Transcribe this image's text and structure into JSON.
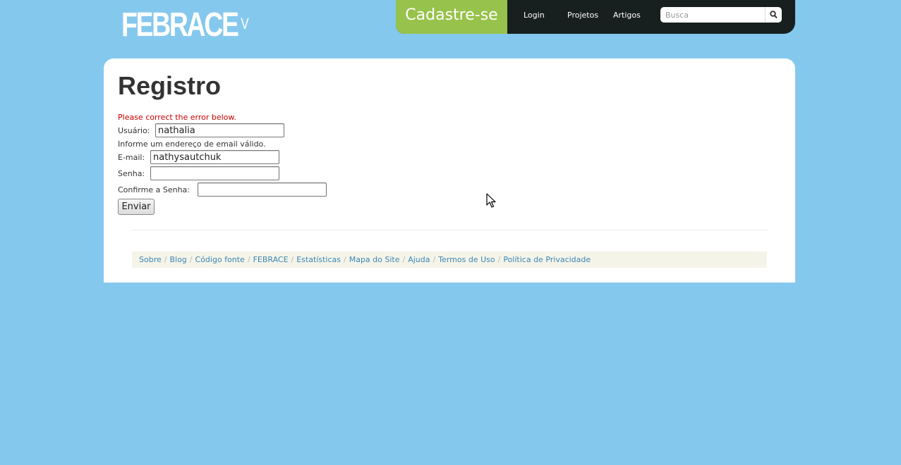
{
  "header": {
    "logo_text": "FEBRACE",
    "logo_sup": "V",
    "cadastre_label": "Cadastre-se",
    "nav": [
      "Login",
      "Projetos",
      "Artigos"
    ],
    "search_placeholder": "Busca",
    "search_icon": "magnifier-icon"
  },
  "form": {
    "title": "Registro",
    "error_message": "Please correct the error below.",
    "usuario_label": "Usuário:",
    "usuario_value": "nathalia",
    "email_error": "Informe um endereço de email válido.",
    "email_label": "E-mail:",
    "email_value": "nathysautchuk",
    "senha_label": "Senha:",
    "senha_value": "",
    "confirme_label": "Confirme a Senha:",
    "confirme_value": "",
    "submit_label": "Enviar"
  },
  "footer": {
    "links": [
      "Sobre",
      "Blog",
      "Código fonte",
      "FEBRACE",
      "Estatísticas",
      "Mapa do Site",
      "Ajuda",
      "Termos de Uso",
      "Política de Privacidade"
    ],
    "separator": "/"
  },
  "colors": {
    "background": "#85c8ee",
    "topbar": "#18201f",
    "cadastre": "#97c24b",
    "error": "#cc0000",
    "link": "#3a86b6"
  }
}
